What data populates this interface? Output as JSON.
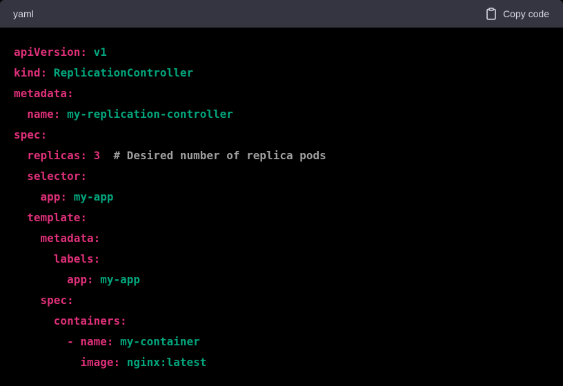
{
  "header": {
    "language": "yaml",
    "copy_label": "Copy code"
  },
  "code": {
    "lines": [
      {
        "indent": "",
        "dash": "",
        "key": "apiVersion:",
        "value": " v1",
        "comment": ""
      },
      {
        "indent": "",
        "dash": "",
        "key": "kind:",
        "value": " ReplicationController",
        "comment": ""
      },
      {
        "indent": "",
        "dash": "",
        "key": "metadata:",
        "value": "",
        "comment": ""
      },
      {
        "indent": "  ",
        "dash": "",
        "key": "name:",
        "value": " my-replication-controller",
        "comment": ""
      },
      {
        "indent": "",
        "dash": "",
        "key": "spec:",
        "value": "",
        "comment": ""
      },
      {
        "indent": "  ",
        "dash": "",
        "key": "replicas:",
        "number": " 3",
        "value": "",
        "comment": "  # Desired number of replica pods"
      },
      {
        "indent": "  ",
        "dash": "",
        "key": "selector:",
        "value": "",
        "comment": ""
      },
      {
        "indent": "    ",
        "dash": "",
        "key": "app:",
        "value": " my-app",
        "comment": ""
      },
      {
        "indent": "  ",
        "dash": "",
        "key": "template:",
        "value": "",
        "comment": ""
      },
      {
        "indent": "    ",
        "dash": "",
        "key": "metadata:",
        "value": "",
        "comment": ""
      },
      {
        "indent": "      ",
        "dash": "",
        "key": "labels:",
        "value": "",
        "comment": ""
      },
      {
        "indent": "        ",
        "dash": "",
        "key": "app:",
        "value": " my-app",
        "comment": ""
      },
      {
        "indent": "    ",
        "dash": "",
        "key": "spec:",
        "value": "",
        "comment": ""
      },
      {
        "indent": "      ",
        "dash": "",
        "key": "containers:",
        "value": "",
        "comment": ""
      },
      {
        "indent": "        ",
        "dash": "- ",
        "key": "name:",
        "value": " my-container",
        "comment": ""
      },
      {
        "indent": "          ",
        "dash": "",
        "key": "image:",
        "value": " nginx:latest",
        "comment": ""
      }
    ]
  },
  "colors": {
    "header_bg": "#343541",
    "code_bg": "#000000",
    "key": "#df3079",
    "string": "#00a67d",
    "comment": "#a0a0a0"
  },
  "icons": {
    "copy": "clipboard-icon"
  }
}
